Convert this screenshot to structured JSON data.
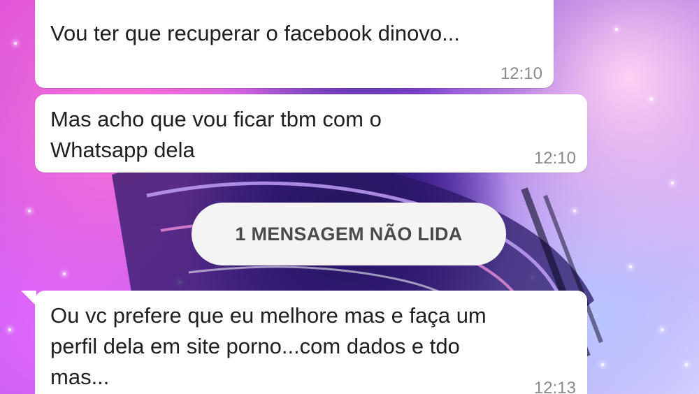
{
  "messages": [
    {
      "text": "Vou ter que recuperar o facebook dinovo...",
      "time": "12:10"
    },
    {
      "text": "Mas acho que vou ficar tbm com o\nWhatsapp dela",
      "time": "12:10"
    },
    {
      "text": "Ou vc prefere que eu melhore mas e faça um\nperfil dela em site porno...com dados e tdo\nmas...",
      "time": "12:13"
    }
  ],
  "unread_divider": {
    "label": "1 MENSAGEM NÃO LIDA"
  },
  "colors": {
    "bubble_incoming": "#ffffff",
    "timestamp": "#8a8a8a",
    "quote_accent": "#1fa885",
    "unread_pill": "#f4f4f4"
  }
}
